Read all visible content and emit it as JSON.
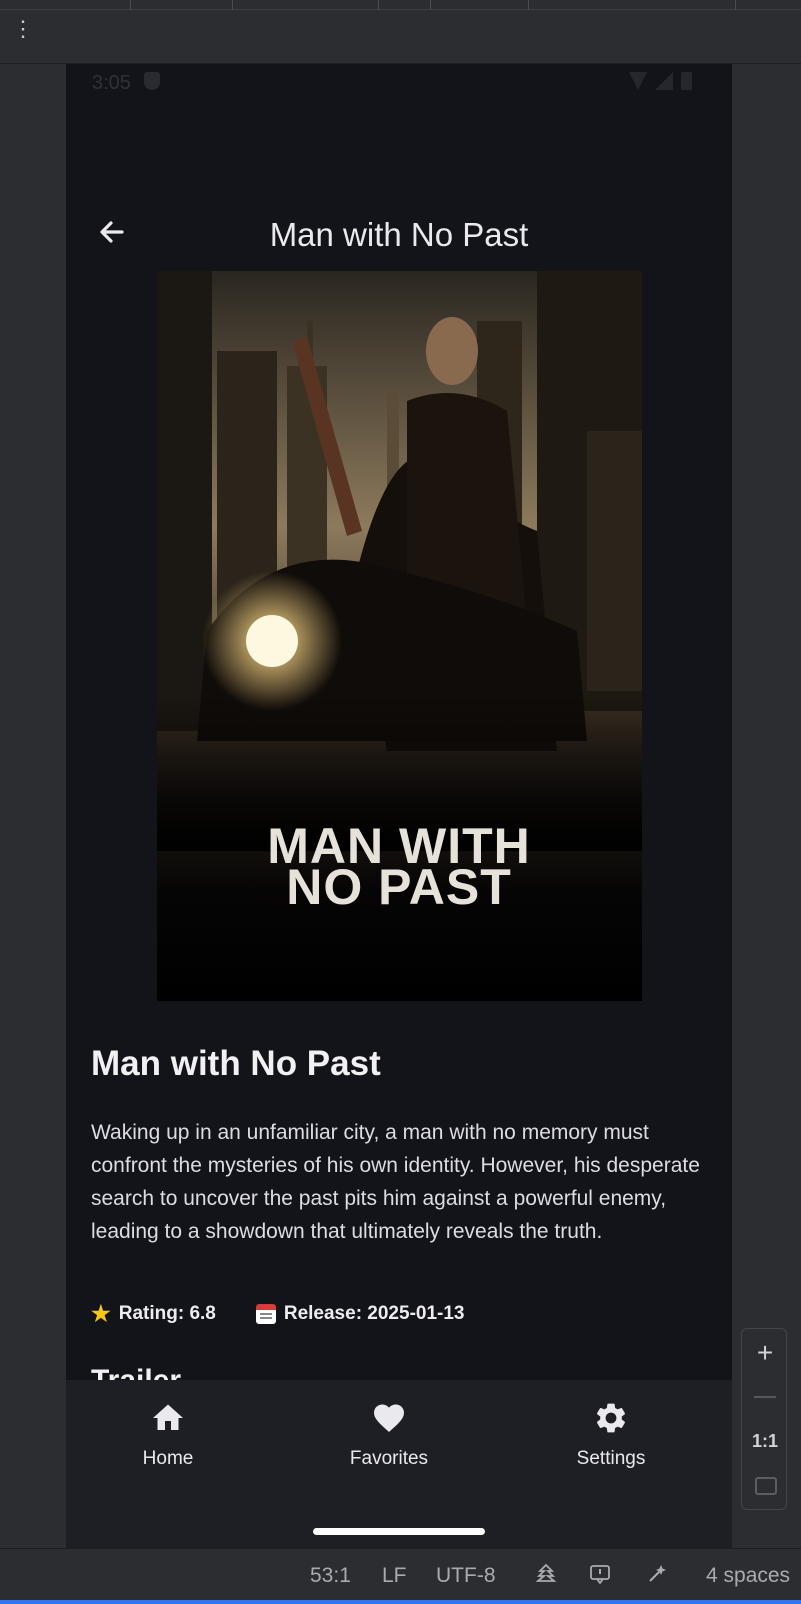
{
  "status_bar": {
    "time": "3:05"
  },
  "app_bar": {
    "title": "Man with No Past"
  },
  "poster": {
    "title_line1": "MAN WITH",
    "title_line2": "NO PAST"
  },
  "movie": {
    "title": "Man with No Past",
    "overview": "Waking up in an unfamiliar city, a man with no memory must confront the mysteries of his own identity. However, his desperate search to uncover the past pits him against a powerful enemy, leading to a showdown that ultimately reveals the truth.",
    "rating_label": "Rating: 6.8",
    "release_label": "Release: 2025-01-13",
    "rating_value": 6.8,
    "release_date": "2025-01-13"
  },
  "next_section_peek": "Trailer",
  "bottom_nav": {
    "items": [
      {
        "label": "Home",
        "icon": "home-icon"
      },
      {
        "label": "Favorites",
        "icon": "heart-icon"
      },
      {
        "label": "Settings",
        "icon": "gear-icon"
      }
    ]
  },
  "zoom_controls": {
    "plus": "+",
    "ratio": "1:1"
  },
  "ide_status_bar": {
    "position": "53:1",
    "line_ending": "LF",
    "encoding": "UTF-8",
    "indent": "4 spaces"
  },
  "colors": {
    "background": "#131419",
    "nav_background": "#1e1f25",
    "ide_chrome": "#2b2d30",
    "star": "#f5c518"
  }
}
